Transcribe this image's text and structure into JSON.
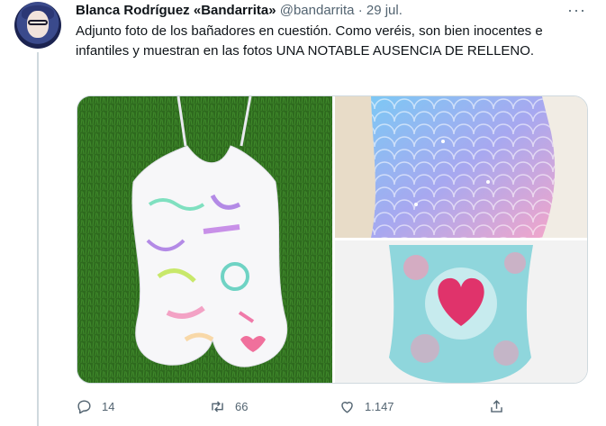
{
  "tweet": {
    "author_name": "Blanca Rodríguez «Bandarrita»",
    "handle": "@bandarrita",
    "separator": "·",
    "date": "29 jul.",
    "more_label": "···",
    "text": "Adjunto foto de los bañadores en cuestión. Como veréis, son bien inocentes e infantiles y muestran en las fotos UNA NOTABLE AUSENCIA DE RELLENO."
  },
  "actions": {
    "replies": "14",
    "retweets": "66",
    "likes": "1.147"
  },
  "icons": {
    "reply": "speech-bubble-icon",
    "retweet": "retweet-arrows-icon",
    "like": "heart-icon",
    "share": "share-upload-icon"
  },
  "colors": {
    "text": "#0f1419",
    "secondary": "#536471",
    "border": "#cfd9de"
  }
}
